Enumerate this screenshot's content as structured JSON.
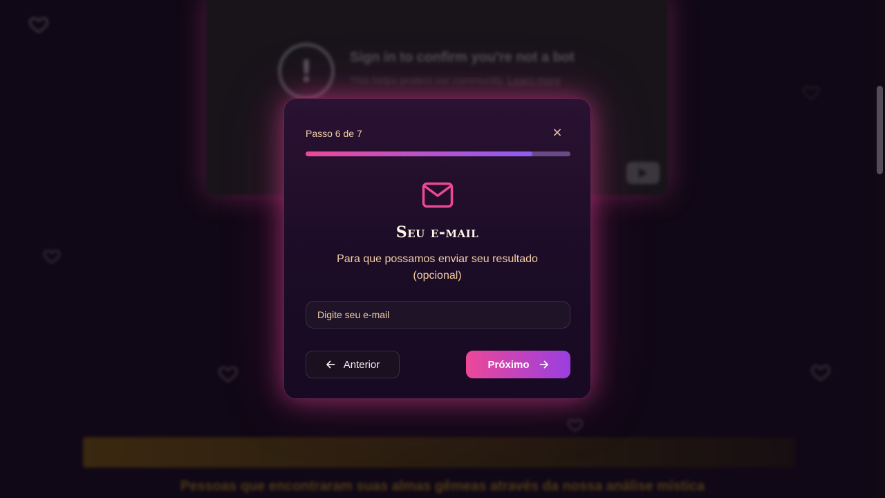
{
  "background": {
    "video": {
      "title": "Sign in to confirm you're not a bot",
      "subtitle": "This helps protect our community.",
      "link": "Learn more",
      "warning_icon": "exclamation-circle-icon",
      "play_icon": "youtube-play-icon"
    },
    "footer_text": "Pessoas que encontraram suas almas gêmeas através da nossa análise mística",
    "decor_icon": "heart-icon"
  },
  "modal": {
    "step_label": "Passo 6 de 7",
    "progress": {
      "current": 6,
      "total": 7
    },
    "close_label": "×",
    "icon": "mail-icon",
    "title": "Seu e-mail",
    "subtitle": "Para que possamos enviar seu resultado (opcional)",
    "email": {
      "placeholder": "Digite seu e-mail",
      "value": ""
    },
    "prev_button": "Anterior",
    "next_button": "Próximo"
  },
  "colors": {
    "accent_pink": "#ec4899",
    "accent_purple": "#8b5cf6",
    "text_gold": "#f2cfa6",
    "background": "#120a18"
  }
}
